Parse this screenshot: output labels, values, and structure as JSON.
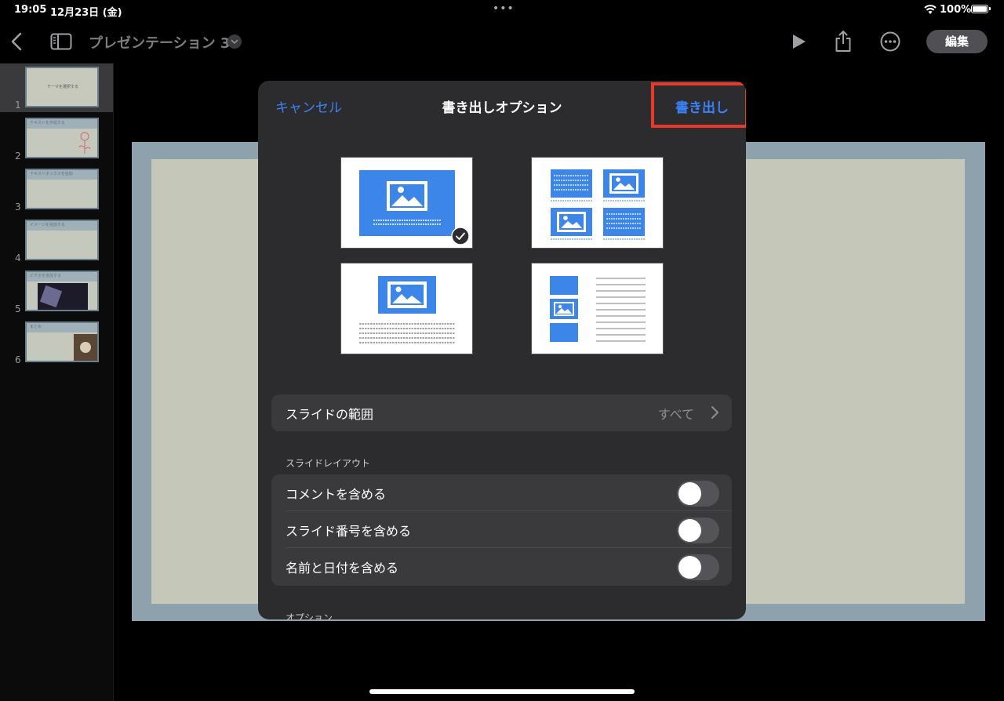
{
  "status_bar": {
    "time": "19:05",
    "date": "12月23日 (金)",
    "multitask_dots": "•••",
    "battery": "100%"
  },
  "toolbar": {
    "doc_title": "プレゼンテーション 3",
    "edit_label": "編集"
  },
  "navigator": {
    "slides": [
      {
        "num": "1",
        "text": "テーマを選択する",
        "selected": true
      },
      {
        "num": "2",
        "text": "テキストを作成する"
      },
      {
        "num": "3",
        "text": "テキストボックスを追加"
      },
      {
        "num": "4",
        "text": "イメージを追加する"
      },
      {
        "num": "5",
        "text": "ビデオを追加する"
      },
      {
        "num": "6",
        "text": "まとめ"
      }
    ]
  },
  "modal": {
    "cancel_label": "キャンセル",
    "title": "書き出しオプション",
    "export_label": "書き出し",
    "slide_range": {
      "label": "スライドの範囲",
      "value": "すべて"
    },
    "layout_section": "スライドレイアウト",
    "toggles": [
      {
        "label": "コメントを含める",
        "on": false
      },
      {
        "label": "スライド番号を含める",
        "on": false
      },
      {
        "label": "名前と日付を含める",
        "on": false
      }
    ],
    "options_section": "オプション"
  },
  "colors": {
    "accent": "#3a82f7",
    "highlight": "#e8392b",
    "layout_blue": "#3b86e8"
  }
}
